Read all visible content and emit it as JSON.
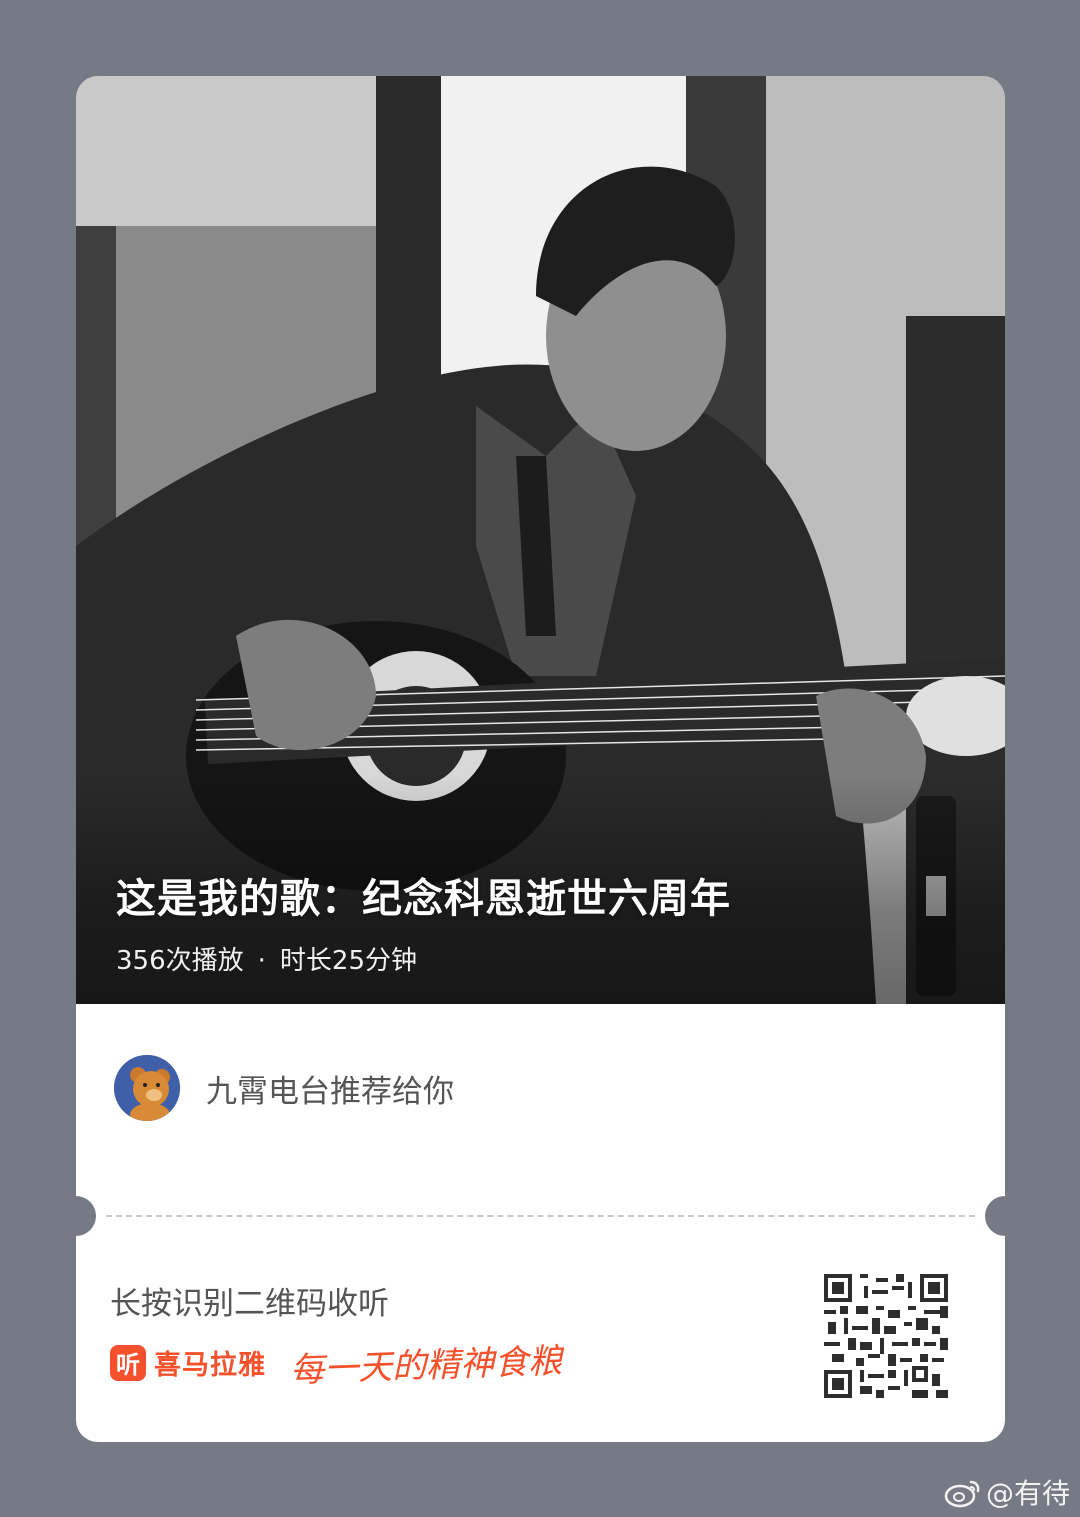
{
  "episode": {
    "title": "这是我的歌：纪念科恩逝世六周年",
    "plays": "356次播放",
    "separator": "·",
    "duration": "时长25分钟"
  },
  "recommender": {
    "text": "九霄电台推荐给你",
    "avatar": "teddy-bear-avatar"
  },
  "footer": {
    "scan_hint": "长按识别二维码收听",
    "brand_icon_char": "听",
    "brand_name": "喜马拉雅",
    "slogan": "每一天的精神食粮"
  },
  "watermark": {
    "text": "@有待",
    "icon": "weibo-icon"
  },
  "colors": {
    "background": "#757a85",
    "brand": "#f4512c"
  }
}
